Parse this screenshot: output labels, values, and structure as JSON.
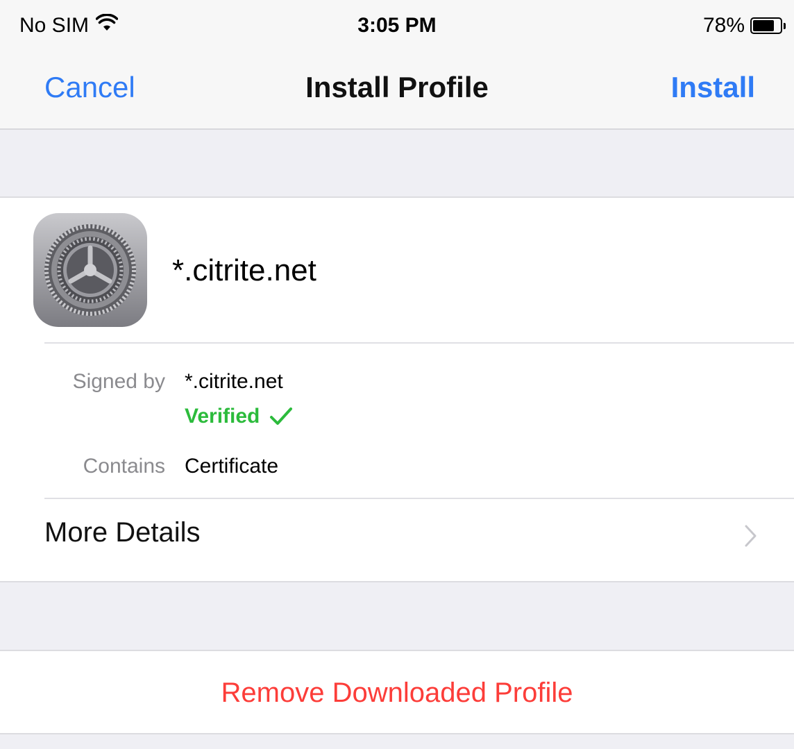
{
  "status_bar": {
    "carrier": "No SIM",
    "time": "3:05 PM",
    "battery_percent": "78%",
    "battery_level": 0.78
  },
  "navbar": {
    "cancel_label": "Cancel",
    "title": "Install Profile",
    "install_label": "Install"
  },
  "profile": {
    "icon": "settings-gear-icon",
    "name": "*.citrite.net",
    "signed_by_label": "Signed by",
    "signed_by_value": "*.citrite.net",
    "verified_label": "Verified",
    "contains_label": "Contains",
    "contains_value": "Certificate"
  },
  "more_details": {
    "label": "More Details"
  },
  "remove_button": {
    "label": "Remove Downloaded Profile"
  },
  "colors": {
    "accent_blue": "#2f7bf5",
    "verified_green": "#2cbb3c",
    "destructive_red": "#fc3d39",
    "grouped_background": "#efeff4"
  }
}
